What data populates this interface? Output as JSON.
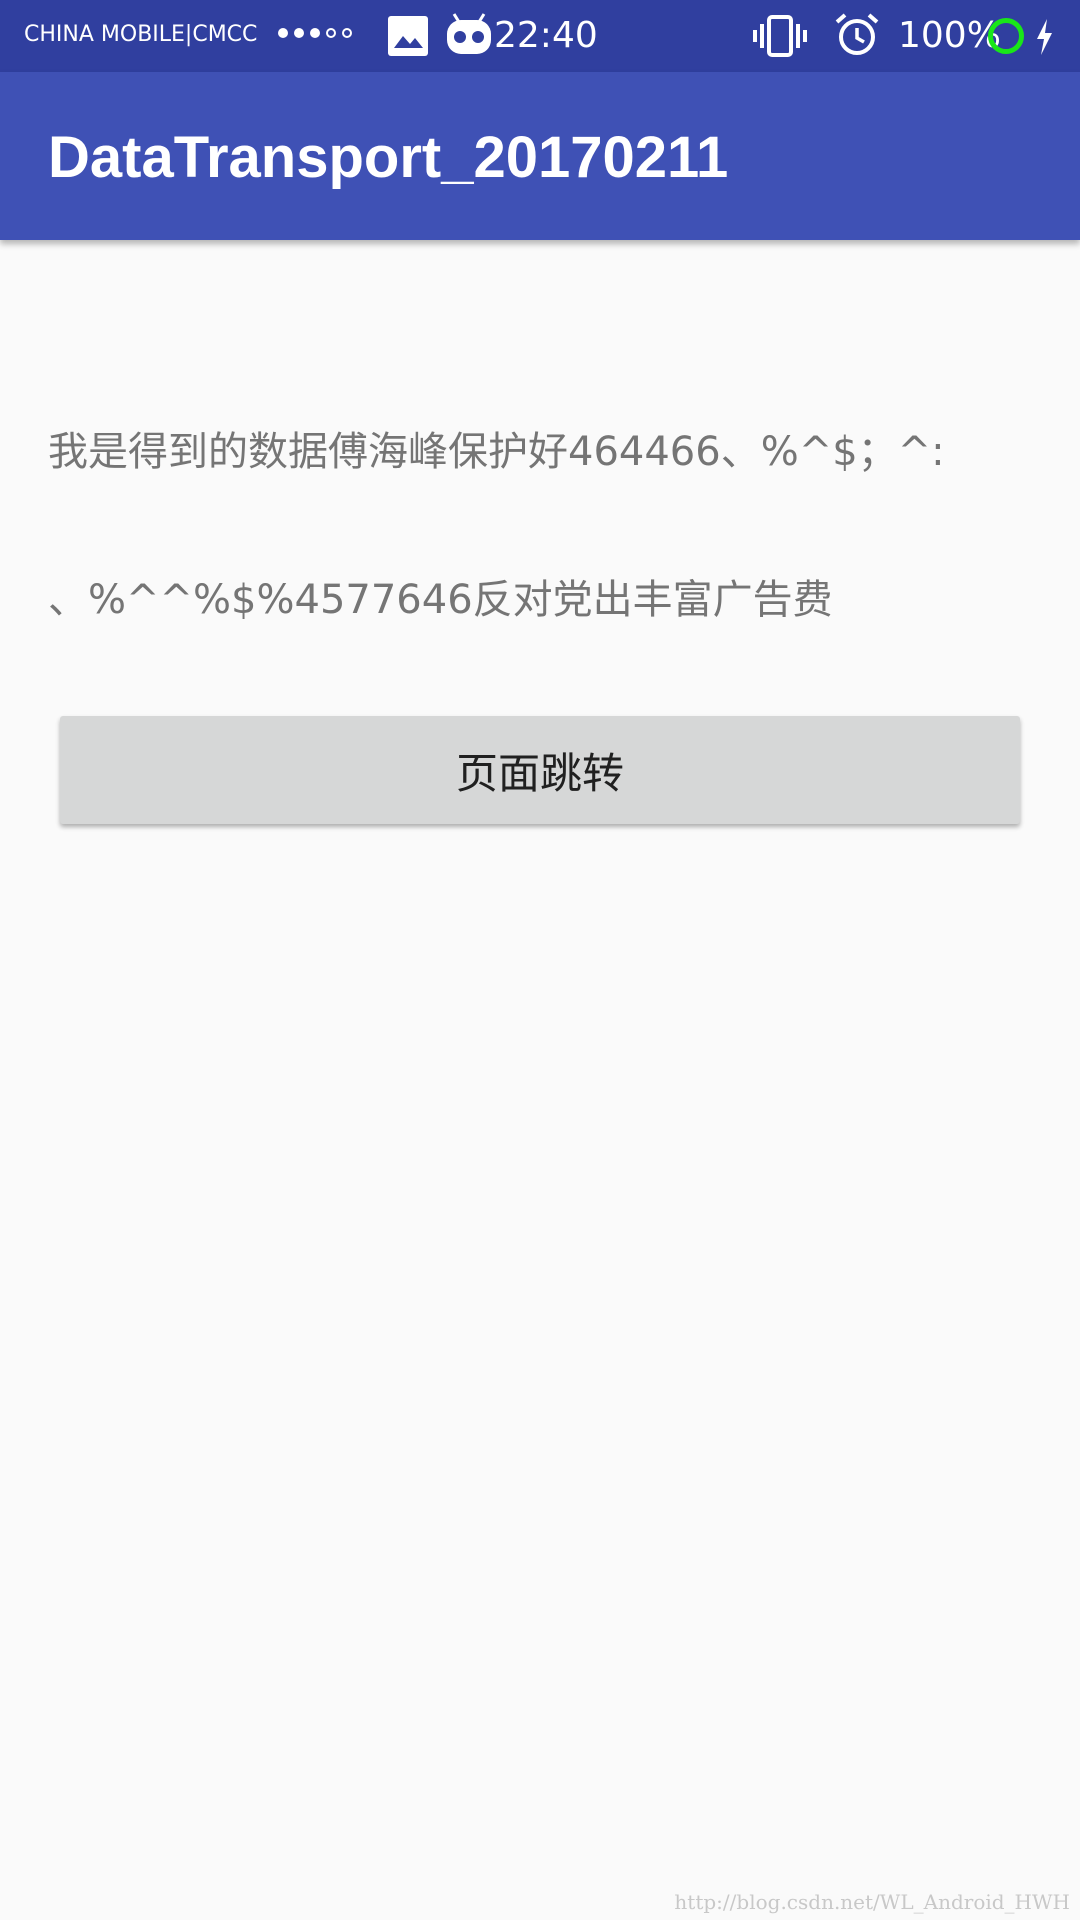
{
  "status_bar": {
    "carrier": "CHINA  MOBILE|CMCC",
    "signal_dots": [
      "filled",
      "filled",
      "filled",
      "empty",
      "empty"
    ],
    "time": "22:40",
    "battery": "100%",
    "icons": [
      "gallery-icon",
      "robot-icon",
      "vibrate-icon",
      "alarm-icon",
      "battery-ring-icon",
      "charging-icon"
    ],
    "colors": {
      "background": "#303f9f",
      "battery_ring": "#19e619"
    }
  },
  "app_bar": {
    "title": "DataTransport_20170211",
    "color": "#3f51b5"
  },
  "content": {
    "line1": "我是得到的数据傅海峰保护好464466、%^$；^:",
    "line2": "、%^^%$%4577646反对党出丰富广告费"
  },
  "button": {
    "label": "页面跳转"
  },
  "watermark": "http://blog.csdn.net/WL_Android_HWH"
}
